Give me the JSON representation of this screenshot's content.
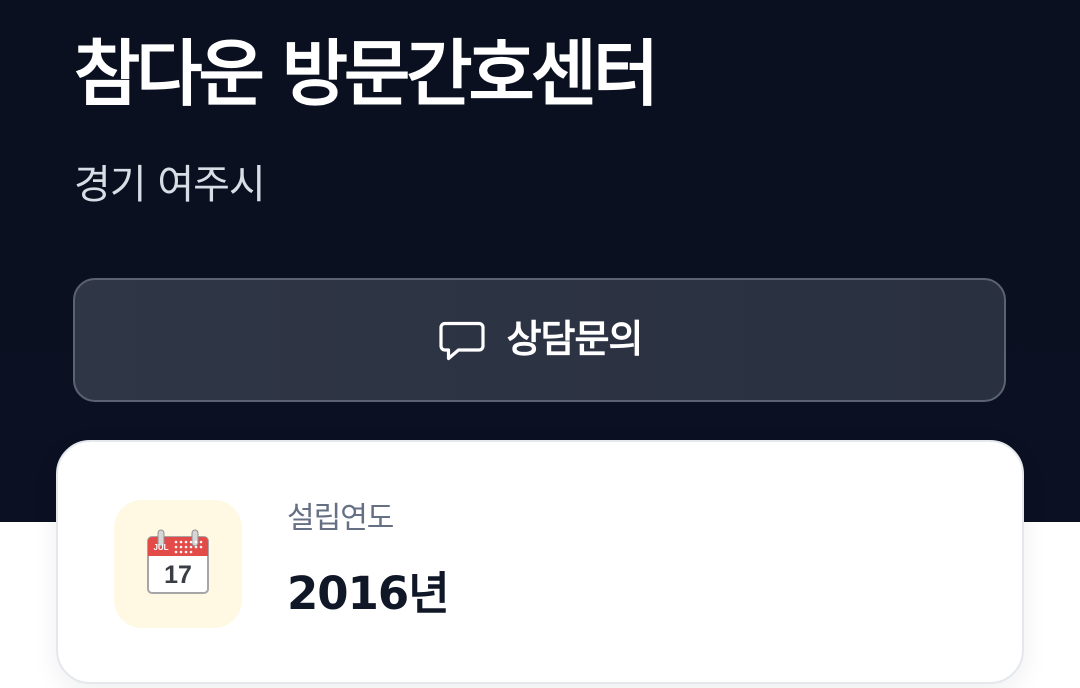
{
  "header": {
    "title": "참다운 방문간호센터",
    "location": "경기 여주시"
  },
  "actions": {
    "consult_label": "상담문의",
    "consult_icon": "message-square-icon"
  },
  "info_card": {
    "icon": "calendar-icon",
    "calendar_month": "JUL",
    "calendar_day": "17",
    "label": "설립연도",
    "value": "2016년"
  },
  "colors": {
    "hero_background": "#0b1020",
    "button_background": "#2d3444",
    "button_border": "#5b6271",
    "card_background": "#ffffff",
    "icon_tile_background": "#fff8e2",
    "calendar_red": "#e34b49"
  }
}
